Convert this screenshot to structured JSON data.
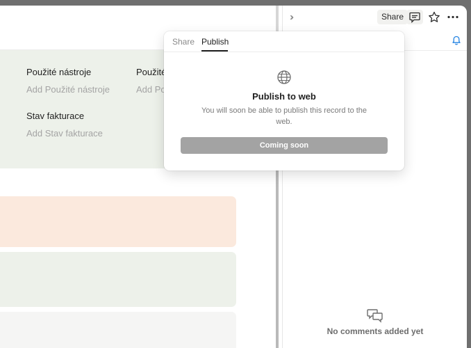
{
  "properties": [
    {
      "label": "Použité nástroje",
      "placeholder": "Add Použité nástroje"
    },
    {
      "label": "Použité",
      "placeholder": "Add Po"
    },
    {
      "label": "Stav fakturace",
      "placeholder": "Add Stav fakturace"
    }
  ],
  "sidebar": {
    "share_label": "Share",
    "no_comments": "No comments added yet"
  },
  "popover": {
    "tabs": [
      "Share",
      "Publish"
    ],
    "active_tab": "Publish",
    "title": "Publish to web",
    "description": "You will soon be able to publish this record to the web.",
    "button_label": "Coming soon"
  },
  "colors": {
    "props_background": "#edf1ea",
    "peach_block": "#fbe9dd",
    "accent_blue": "#2383e2",
    "disabled_button": "#a3a3a3"
  }
}
